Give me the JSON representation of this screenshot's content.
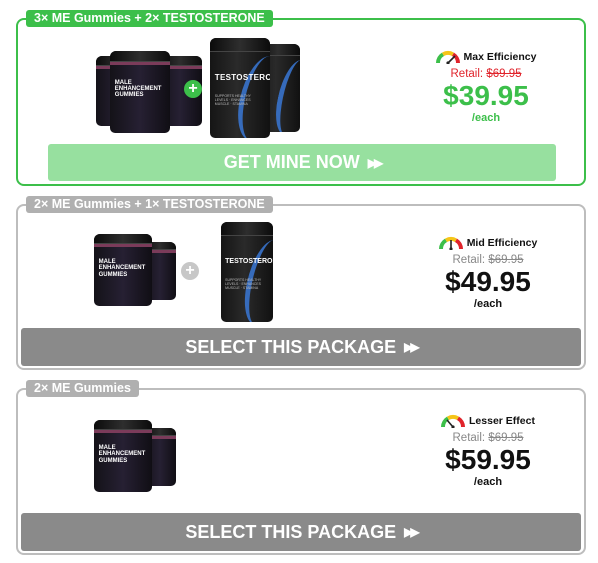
{
  "packages": [
    {
      "tag": "3× ME Gummies + 2× TESTOSTERONE",
      "efficiency": "Max Efficiency",
      "retail_label": "Retail:",
      "retail_price": "$69.95",
      "price": "$39.95",
      "each": "/each",
      "button": "GET MINE NOW",
      "gauge_level": "high",
      "gummies_count": 3,
      "testosterone_count": 2
    },
    {
      "tag": "2× ME Gummies + 1× TESTOSTERONE",
      "efficiency": "Mid Efficiency",
      "retail_label": "Retail:",
      "retail_price": "$69.95",
      "price": "$49.95",
      "each": "/each",
      "button": "SELECT THIS PACKAGE",
      "gauge_level": "mid",
      "gummies_count": 2,
      "testosterone_count": 1
    },
    {
      "tag": "2× ME Gummies",
      "efficiency": "Lesser Effect",
      "retail_label": "Retail:",
      "retail_price": "$69.95",
      "price": "$59.95",
      "each": "/each",
      "button": "SELECT THIS PACKAGE",
      "gauge_level": "low",
      "gummies_count": 2,
      "testosterone_count": 0
    }
  ],
  "bottle_labels": {
    "gummies_line1": "MALE",
    "gummies_line2": "ENHANCEMENT",
    "gummies_line3": "GUMMIES",
    "testosterone": "TESTOSTERONE"
  },
  "icons": {
    "plus": "plus-icon",
    "gauge": "gauge-icon",
    "arrow": "double-arrow-icon"
  },
  "colors": {
    "green": "#3cbf4a",
    "green_button": "#97e09f",
    "gray_button": "#8a8a8a",
    "retail_red": "#e0232b"
  }
}
